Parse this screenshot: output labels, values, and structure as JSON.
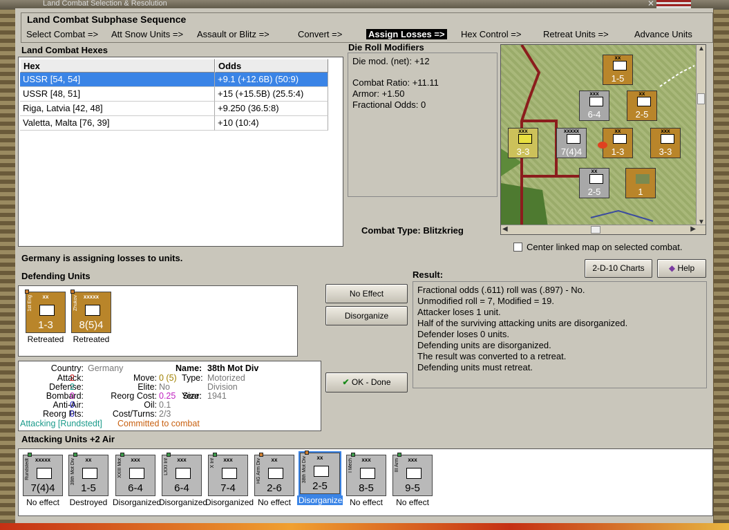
{
  "window": {
    "title": "Land Combat Selection & Resolution"
  },
  "subphase": {
    "title": "Land Combat Subphase Sequence",
    "steps": [
      "Select Combat =>",
      "Att Snow Units =>",
      "Assault or Blitz =>",
      "Convert =>",
      "Assign Losses =>",
      "Hex Control =>",
      "Retreat Units =>",
      "Advance Units"
    ],
    "active_index": 4
  },
  "hexes": {
    "label": "Land Combat Hexes",
    "columns": [
      "Hex",
      "Odds"
    ],
    "rows": [
      [
        "USSR [54, 54]",
        "+9.1 (+12.6B) (50:9)"
      ],
      [
        "USSR [48, 51]",
        "+15 (+15.5B) (25.5:4)"
      ],
      [
        "Riga, Latvia [42, 48]",
        "+9.250 (36.5:8)"
      ],
      [
        "Valetta, Malta [76, 39]",
        "+10 (10:4)"
      ]
    ],
    "selected_row": 0
  },
  "die_roll": {
    "label": "Die Roll Modifiers",
    "lines": [
      "Die mod. (net): +12",
      "Combat Ratio: +11.11",
      "Armor: +1.50",
      "Fractional Odds: 0"
    ]
  },
  "map": {
    "counters": [
      {
        "value": "1-5",
        "size": "xx",
        "side": "ger"
      },
      {
        "value": "6-4",
        "size": "xxx",
        "side": "ussr"
      },
      {
        "value": "2-5",
        "size": "xx",
        "side": "ger"
      },
      {
        "value": "7(4)4",
        "size": "xxxxx",
        "side": "ussr"
      },
      {
        "value": "1-3",
        "size": "xx",
        "side": "ger"
      },
      {
        "value": "3-3",
        "size": "xxx",
        "side": "ger"
      },
      {
        "value": "3-3",
        "size": "xxx",
        "side": "fin"
      },
      {
        "value": "2-5",
        "size": "xx",
        "side": "ussr"
      },
      {
        "value": "1",
        "size": "",
        "side": "ger"
      }
    ]
  },
  "combat_type": {
    "label": "Combat Type:",
    "value": "Blitzkrieg"
  },
  "center_map": {
    "label": "Center linked map on selected combat.",
    "checked": false
  },
  "assigning_text": "Germany is assigning losses to units.",
  "buttons": {
    "charts": "2-D-10 Charts",
    "help": "Help",
    "no_effect": "No Effect",
    "disorganize": "Disorganize",
    "ok_done": "OK - Done"
  },
  "defending": {
    "label": "Defending Units",
    "units": [
      {
        "name": "1st Eng",
        "size": "xx",
        "value": "1-3",
        "status": "Retreated"
      },
      {
        "name": "Zhukov",
        "size": "xxxxx",
        "value": "8(5)4",
        "status": "Retreated"
      }
    ]
  },
  "info": {
    "country_label": "Country:",
    "country": "Germany",
    "attack_label": "Attack:",
    "attack": "2",
    "defense_label": "Defense:",
    "defense": "2",
    "bombard_label": "Bombard:",
    "bombard": "0",
    "antiair_label": "Anti-Air:",
    "antiair": "0",
    "reorg_pts_label": "Reorg Pts:",
    "reorg_pts": "0",
    "name_label": "Name:",
    "name": "38th Mot Div",
    "move_label": "Move:",
    "move": "0 (5)",
    "elite_label": "Elite:",
    "elite": "No",
    "reorg_cost_label": "Reorg Cost:",
    "reorg_cost": "0.25",
    "oil_label": "Oil:",
    "oil": "0.1",
    "cost_turns_label": "Cost/Turns:",
    "cost_turns": "2/3",
    "type_label": "Type:",
    "type": "Motorized",
    "division_label": "Division",
    "size_label": "Size:",
    "year_label": "Year:",
    "year": "1941",
    "attacking": "Attacking [Rundstedt]",
    "committed": "Committed to combat"
  },
  "result": {
    "label": "Result:",
    "lines": [
      "Fractional odds (.611) roll was (.897)  - No.",
      "Unmodified roll = 7, Modified = 19.",
      "Attacker loses 1 unit.",
      "Half of the surviving attacking units are disorganized.",
      "Defender loses 0 units.",
      "Defending units are disorganized.",
      "The result was converted to a retreat.",
      "Defending units must retreat."
    ]
  },
  "attacking": {
    "label": "Attacking Units +2 Air",
    "units": [
      {
        "name": "Rundstedt",
        "size": "xxxxx",
        "value": "7(4)4",
        "status": "No effect"
      },
      {
        "name": "39th Mot Div",
        "size": "xx",
        "value": "1-5",
        "status": "Destroyed"
      },
      {
        "name": "XXIII Mot",
        "size": "xxx",
        "value": "6-4",
        "status": "Disorganized"
      },
      {
        "name": "LXXI Inf",
        "size": "xxx",
        "value": "6-4",
        "status": "Disorganized"
      },
      {
        "name": "X Inf",
        "size": "xxx",
        "value": "7-4",
        "status": "Disorganized"
      },
      {
        "name": "HG Arm Div",
        "size": "xx",
        "value": "2-6",
        "status": "No effect"
      },
      {
        "name": "38th Mot Div",
        "size": "xx",
        "value": "2-5",
        "status": "Disorganized"
      },
      {
        "name": "I Mech",
        "size": "xxx",
        "value": "8-5",
        "status": "No effect"
      },
      {
        "name": "III Arm",
        "size": "xxx",
        "value": "9-5",
        "status": "No effect"
      }
    ],
    "selected_index": 6
  },
  "colors": {
    "selection": "#3a84e6",
    "german_counter": "#b9852a",
    "attack_red": "#cc2020",
    "cyan_green": "#1a9a8a",
    "committed_orange": "#c86010"
  }
}
